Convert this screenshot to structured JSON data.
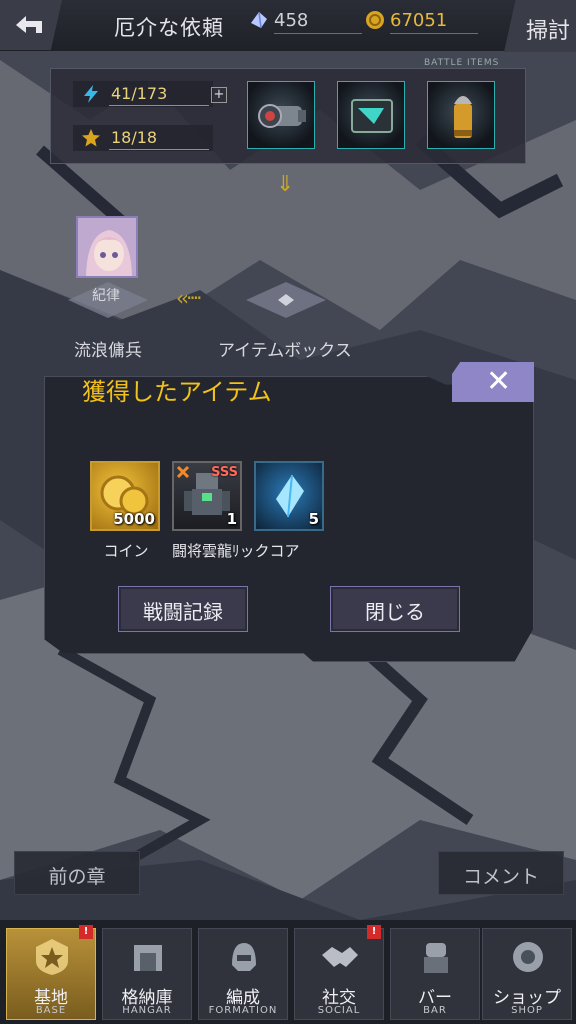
{
  "header": {
    "title": "厄介な依頼",
    "gems": "458",
    "coins": "67051",
    "sweep_label": "掃討",
    "back_icon": "back-arrow-icon"
  },
  "stage": {
    "stamina": "41/173",
    "stars": "18/18",
    "battle_items_label": "BATTLE ITEMS",
    "items": [
      "scope-icon",
      "chip-icon",
      "shell-icon"
    ]
  },
  "map": {
    "node_left_tag": "紀律",
    "node_left_label": "流浪傭兵",
    "node_right_label": "アイテムボックス"
  },
  "dialog": {
    "title": "獲得したアイテム",
    "close_symbol": "✕",
    "rewards": [
      {
        "name": "コイン",
        "qty": "5000"
      },
      {
        "name": "闘将雲龍ﾘックコア",
        "qty": "1",
        "rank": "SSS"
      },
      {
        "name": "",
        "qty": "5"
      }
    ],
    "record_button": "戦闘記録",
    "close_button": "閉じる"
  },
  "footer_buttons": {
    "prev_chapter": "前の章",
    "comment": "コメント"
  },
  "nav": [
    {
      "jp": "基地",
      "en": "BASE",
      "active": true,
      "badge": "!"
    },
    {
      "jp": "格納庫",
      "en": "HANGAR",
      "active": false
    },
    {
      "jp": "編成",
      "en": "FORMATION",
      "active": false
    },
    {
      "jp": "社交",
      "en": "SOCIAL",
      "active": false,
      "badge": "!"
    },
    {
      "jp": "バー",
      "en": "BAR",
      "active": false
    },
    {
      "jp": "ショップ",
      "en": "SHOP",
      "active": false
    }
  ],
  "colors": {
    "accent": "#f2c21a",
    "close": "#8f86c8",
    "active_tab": "#b8913a"
  }
}
